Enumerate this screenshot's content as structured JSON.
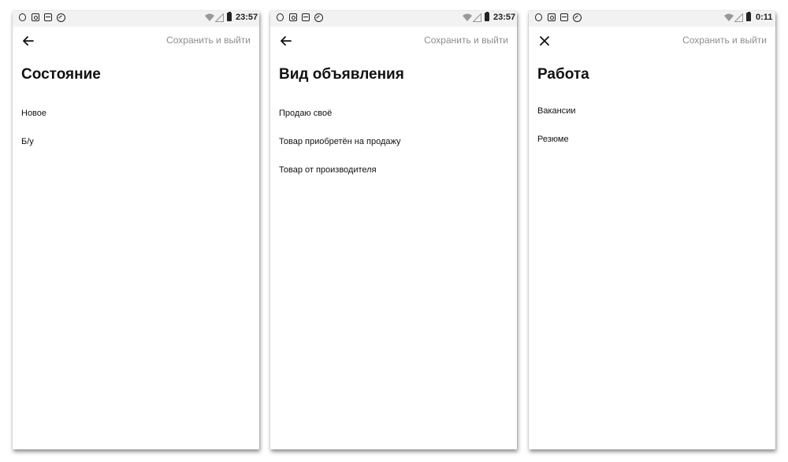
{
  "screens": [
    {
      "status_bar": {
        "time": "23:57"
      },
      "nav_icon": "back-arrow-icon",
      "save_label": "Сохранить и выйти",
      "title": "Состояние",
      "options": [
        "Новое",
        "Б/у"
      ]
    },
    {
      "status_bar": {
        "time": "23:57"
      },
      "nav_icon": "back-arrow-icon",
      "save_label": "Сохранить и выйти",
      "title": "Вид объявления",
      "options": [
        "Продаю своё",
        "Товар приобретён на продажу",
        "Товар от производителя"
      ]
    },
    {
      "status_bar": {
        "time": "0:11"
      },
      "nav_icon": "close-icon",
      "save_label": "Сохранить и выйти",
      "title": "Работа",
      "options": [
        "Вакансии",
        "Резюме"
      ]
    }
  ],
  "status_icons": [
    "opera-icon",
    "instagram-icon",
    "message-icon",
    "vpn-icon",
    "wifi-icon",
    "signal-icon",
    "battery-icon"
  ]
}
